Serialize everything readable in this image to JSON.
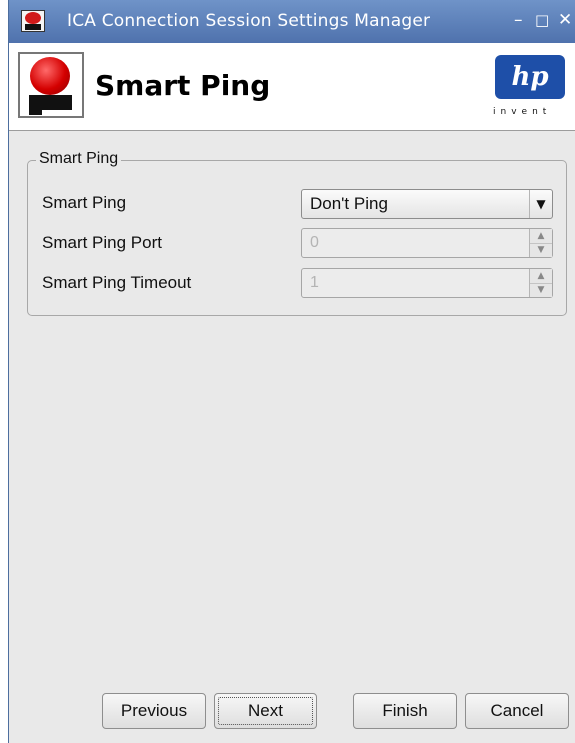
{
  "window": {
    "title": "ICA Connection Session Settings Manager",
    "minimize_glyph": "–",
    "maximize_glyph": "□",
    "close_glyph": "✕"
  },
  "header": {
    "page_title": "Smart Ping",
    "hp_logo_text": "hp",
    "hp_tagline": "invent"
  },
  "group": {
    "legend": "Smart Ping",
    "fields": [
      {
        "label": "Smart Ping",
        "type": "combo",
        "value": "Don't Ping"
      },
      {
        "label": "Smart Ping Port",
        "type": "spin",
        "value": "0",
        "enabled": false
      },
      {
        "label": "Smart Ping Timeout",
        "type": "spin",
        "value": "1",
        "enabled": false
      }
    ]
  },
  "buttons": {
    "previous": "Previous",
    "next": "Next",
    "finish": "Finish",
    "cancel": "Cancel"
  },
  "icons": {
    "app_icon": "ica-client-icon",
    "combo_arrow": "▼",
    "spin_up": "▲",
    "spin_down": "▼"
  },
  "colors": {
    "titlebar": "#5a7db9",
    "background": "#e9e9e9",
    "hp_blue": "#1e4fa8",
    "logo_red": "#d40000"
  }
}
